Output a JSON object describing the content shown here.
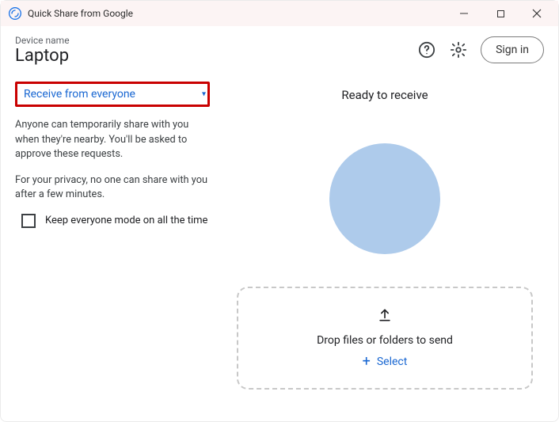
{
  "window": {
    "title": "Quick Share from Google"
  },
  "header": {
    "device_label": "Device name",
    "device_name": "Laptop",
    "signin": "Sign in"
  },
  "left": {
    "dropdown_label": "Receive from everyone",
    "info1": "Anyone can temporarily share with you when they're nearby. You'll be asked to approve these requests.",
    "info2": "For your privacy, no one can share with you after a few minutes.",
    "checkbox_label": "Keep everyone mode on all the time"
  },
  "right": {
    "ready_title": "Ready to receive",
    "drop_text": "Drop files or folders to send",
    "select_label": "Select"
  }
}
